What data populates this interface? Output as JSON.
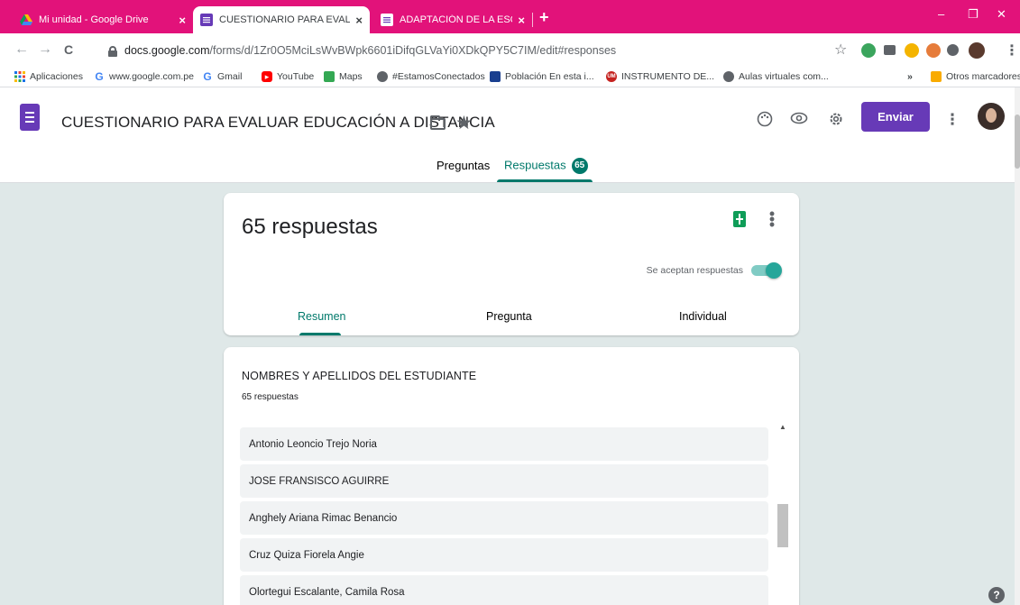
{
  "browser": {
    "tabs": [
      {
        "title": "Mi unidad - Google Drive",
        "close": "×"
      },
      {
        "title": "CUESTIONARIO PARA EVALUAR E",
        "close": "×"
      },
      {
        "title": "ADAPTACIÓN DE LA ESCALA DE",
        "close": "×"
      }
    ],
    "new_tab": "+",
    "window_controls": {
      "minimize": "–",
      "restore": "❐",
      "close": "✕"
    },
    "nav": {
      "back": "←",
      "forward": "→",
      "reload": "C"
    },
    "url_host": "docs.google.com",
    "url_path": "/forms/d/1Zr0O5MciLsWvBWpk6601iDifqGLVaYi0XDkQPY5C7IM/edit#responses",
    "star": "☆",
    "menu": "⋮",
    "bookmarks": [
      "Aplicaciones",
      "www.google.com.pe",
      "Gmail",
      "YouTube",
      "Maps",
      "#EstamosConectados",
      "Población En esta i...",
      "INSTRUMENTO DE...",
      "Aulas virtuales com..."
    ],
    "bookmarks_more": "»",
    "other_bookmarks": "Otros marcadores"
  },
  "form": {
    "title": "CUESTIONARIO PARA EVALUAR EDUCACIÓN A DISTANCIA",
    "send_label": "Enviar",
    "tabs": {
      "questions": "Preguntas",
      "responses": "Respuestas",
      "responses_badge": "65"
    }
  },
  "summary": {
    "count_label": "65 respuestas",
    "accepting_label": "Se aceptan respuestas",
    "accepting": true,
    "tabs": {
      "summary": "Resumen",
      "question": "Pregunta",
      "individual": "Individual"
    }
  },
  "question": {
    "title": "NOMBRES Y APELLIDOS DEL ESTUDIANTE",
    "count_label": "65 respuestas",
    "responses": [
      "Antonio Leoncio Trejo Noria",
      "JOSE FRANSISCO AGUIRRE",
      "Anghely Ariana Rimac Benancio",
      "Cruz Quiza Fiorela Angie",
      "Olortegui Escalante, Camila Rosa"
    ]
  },
  "help": "?"
}
